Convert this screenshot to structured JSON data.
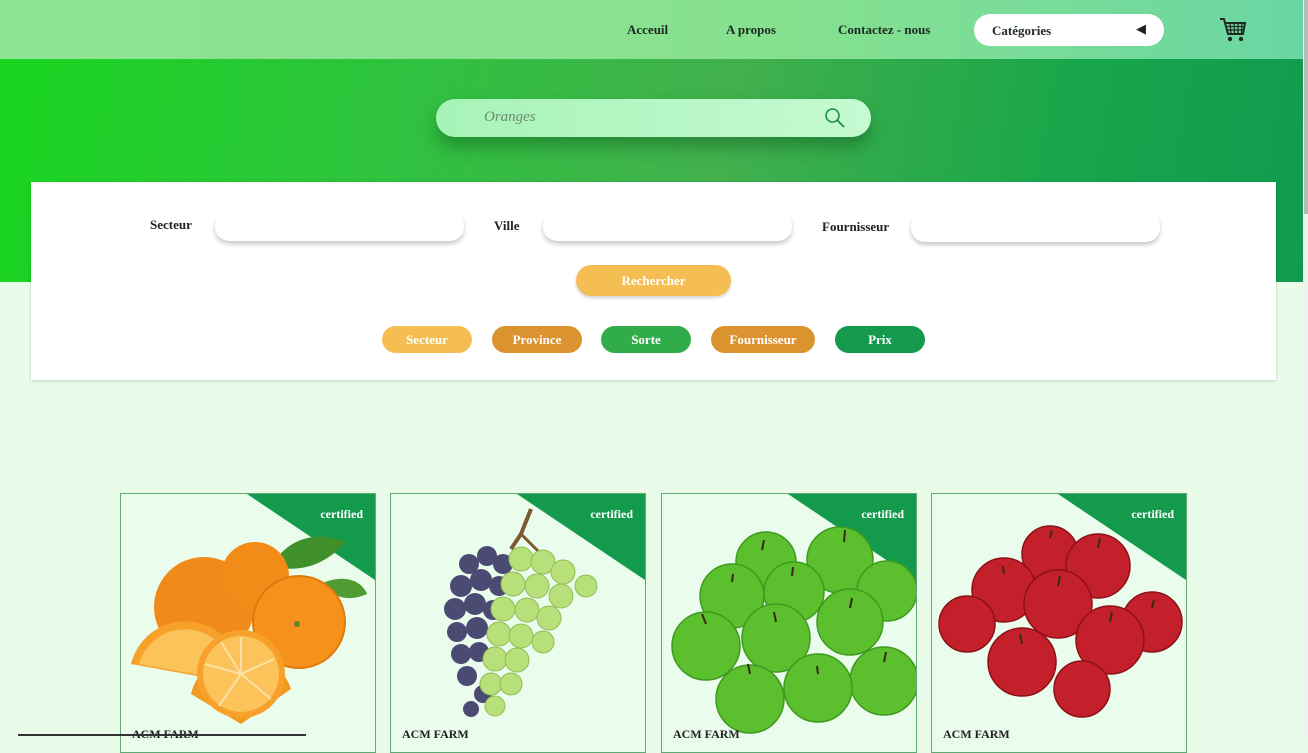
{
  "nav": {
    "links": [
      "Acceuil",
      "A propos",
      "Contactez - nous"
    ],
    "categories_label": "Catégories",
    "cart_icon": "shopping-cart-icon"
  },
  "search": {
    "value": "Oranges",
    "icon": "search-icon"
  },
  "filters": {
    "secteur_label": "Secteur",
    "ville_label": "Ville",
    "fournisseur_label": "Fournisseur",
    "button_label": "Rechercher"
  },
  "chips": [
    {
      "label": "Secteur",
      "color": "#f4be52"
    },
    {
      "label": "Province",
      "color": "#db9330"
    },
    {
      "label": "Sorte",
      "color": "#30ad4a"
    },
    {
      "label": "Fournisseur",
      "color": "#db9330"
    },
    {
      "label": "Prix",
      "color": "#15994c"
    }
  ],
  "products": [
    {
      "fruit": "oranges",
      "badge": "certified",
      "farm": "ACM FARM"
    },
    {
      "fruit": "grapes",
      "badge": "certified",
      "farm": "ACM FARM"
    },
    {
      "fruit": "green apples",
      "badge": "certified",
      "farm": "ACM FARM"
    },
    {
      "fruit": "red apples",
      "badge": "certified",
      "farm": "ACM FARM"
    }
  ],
  "colors": {
    "accent_green": "#149a4d",
    "button_yellow": "#f4be52",
    "background": "#e8fce9"
  }
}
